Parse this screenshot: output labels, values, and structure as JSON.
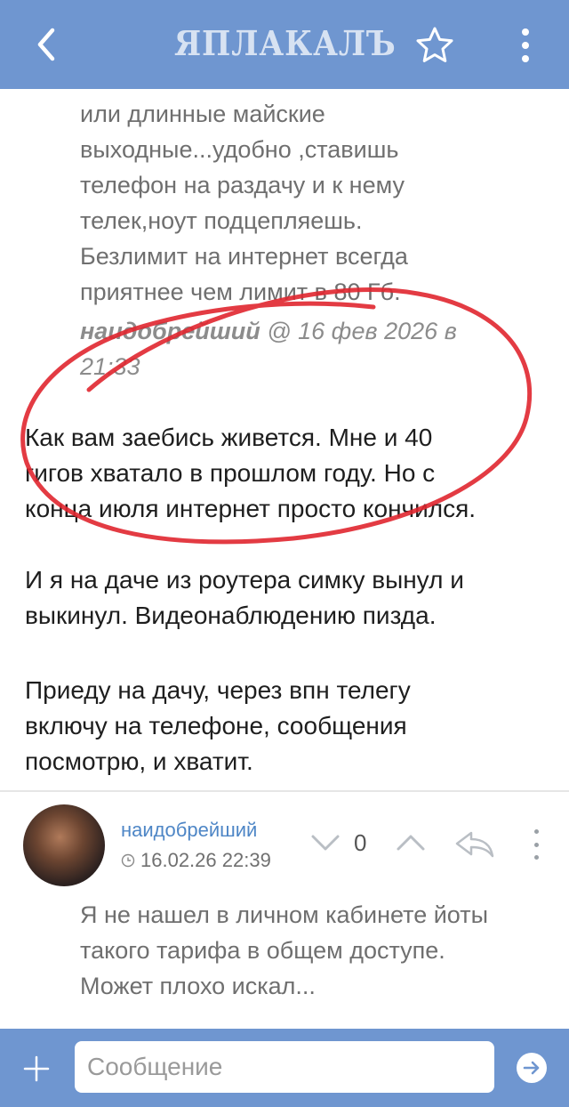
{
  "header": {
    "logo_text": "ЯПЛАКАЛЪ",
    "back_icon": "chevron-left-icon",
    "favorite_icon": "star-icon",
    "menu_icon": "more-vertical-icon"
  },
  "quote": {
    "lines": [
      "или длинные майские",
      "выходные...удобно ,ставишь",
      "телефон на раздачу и к нему",
      "телек,ноут подцепляешь.",
      "Безлимит на интернет всегда",
      "приятнее чем лимит в 80 Гб."
    ],
    "author": "наидобрейший",
    "cite_rest": " @ 16 фев 2026 в",
    "cite_time": "21:33"
  },
  "post_body": {
    "p1_lines": [
      "Как вам заебись живется. Мне и 40",
      "гигов хватало в прошлом году. Но с",
      "конца июля интернет просто кончился."
    ],
    "p2_lines": [
      "И я на даче из роутера симку вынул и",
      "выкинул. Видеонаблюдению пизда."
    ],
    "p3_lines": [
      "Приеду на дачу, через впн телегу",
      "включу на телефоне, сообщения",
      "посмотрю, и хватит."
    ]
  },
  "comment": {
    "author": "наидобрейший",
    "datetime": "16.02.26 22:39",
    "score": "0",
    "lines": [
      "Я не нашел в личном кабинете йоты",
      "такого тарифа в общем доступе.",
      "Может плохо искал..."
    ]
  },
  "composer": {
    "placeholder": "Сообщение"
  },
  "colors": {
    "bar": "#6f96d0",
    "link": "#4e86c6",
    "annotation": "#e0262f"
  }
}
